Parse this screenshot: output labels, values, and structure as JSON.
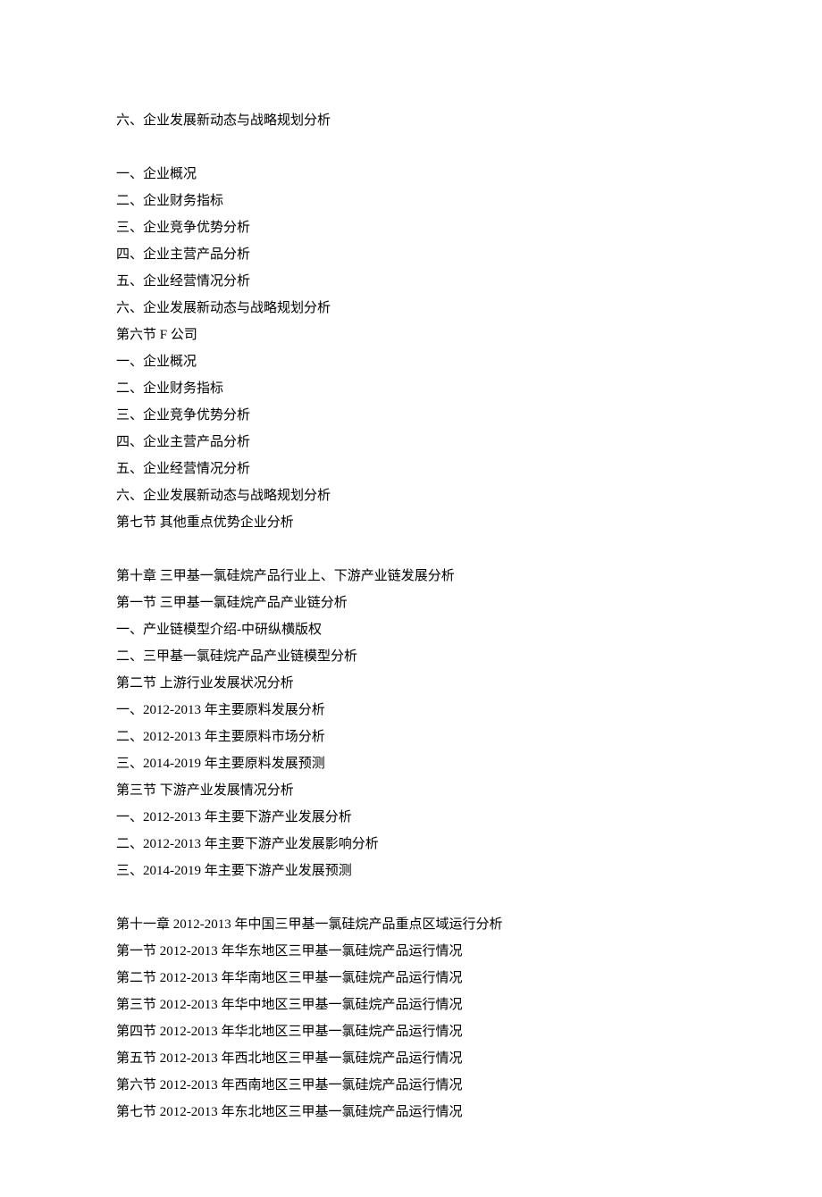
{
  "block1": {
    "line1": "六、企业发展新动态与战略规划分析"
  },
  "block2": {
    "line1": "一、企业概况",
    "line2": "二、企业财务指标",
    "line3": "三、企业竞争优势分析",
    "line4": "四、企业主营产品分析",
    "line5": "五、企业经营情况分析",
    "line6": "六、企业发展新动态与战略规划分析",
    "line7": "第六节 F 公司",
    "line8": "一、企业概况",
    "line9": "二、企业财务指标",
    "line10": "三、企业竞争优势分析",
    "line11": "四、企业主营产品分析",
    "line12": "五、企业经营情况分析",
    "line13": "六、企业发展新动态与战略规划分析",
    "line14": "第七节 其他重点优势企业分析"
  },
  "block3": {
    "line1": "第十章 三甲基一氯硅烷产品行业上、下游产业链发展分析",
    "line2": "第一节 三甲基一氯硅烷产品产业链分析",
    "line3": "一、产业链模型介绍-中研纵横版权",
    "line4": "二、三甲基一氯硅烷产品产业链模型分析",
    "line5": "第二节 上游行业发展状况分析",
    "line6": "一、2012-2013 年主要原料发展分析",
    "line7": "二、2012-2013 年主要原料市场分析",
    "line8": "三、2014-2019 年主要原料发展预测",
    "line9": "第三节 下游产业发展情况分析",
    "line10": "一、2012-2013 年主要下游产业发展分析",
    "line11": "二、2012-2013 年主要下游产业发展影响分析",
    "line12": "三、2014-2019 年主要下游产业发展预测"
  },
  "block4": {
    "line1": "第十一章 2012-2013 年中国三甲基一氯硅烷产品重点区域运行分析",
    "line2": "第一节 2012-2013 年华东地区三甲基一氯硅烷产品运行情况",
    "line3": "第二节 2012-2013 年华南地区三甲基一氯硅烷产品运行情况",
    "line4": "第三节 2012-2013 年华中地区三甲基一氯硅烷产品运行情况",
    "line5": "第四节 2012-2013 年华北地区三甲基一氯硅烷产品运行情况",
    "line6": "第五节 2012-2013 年西北地区三甲基一氯硅烷产品运行情况",
    "line7": "第六节 2012-2013 年西南地区三甲基一氯硅烷产品运行情况",
    "line8": "第七节 2012-2013 年东北地区三甲基一氯硅烷产品运行情况"
  }
}
